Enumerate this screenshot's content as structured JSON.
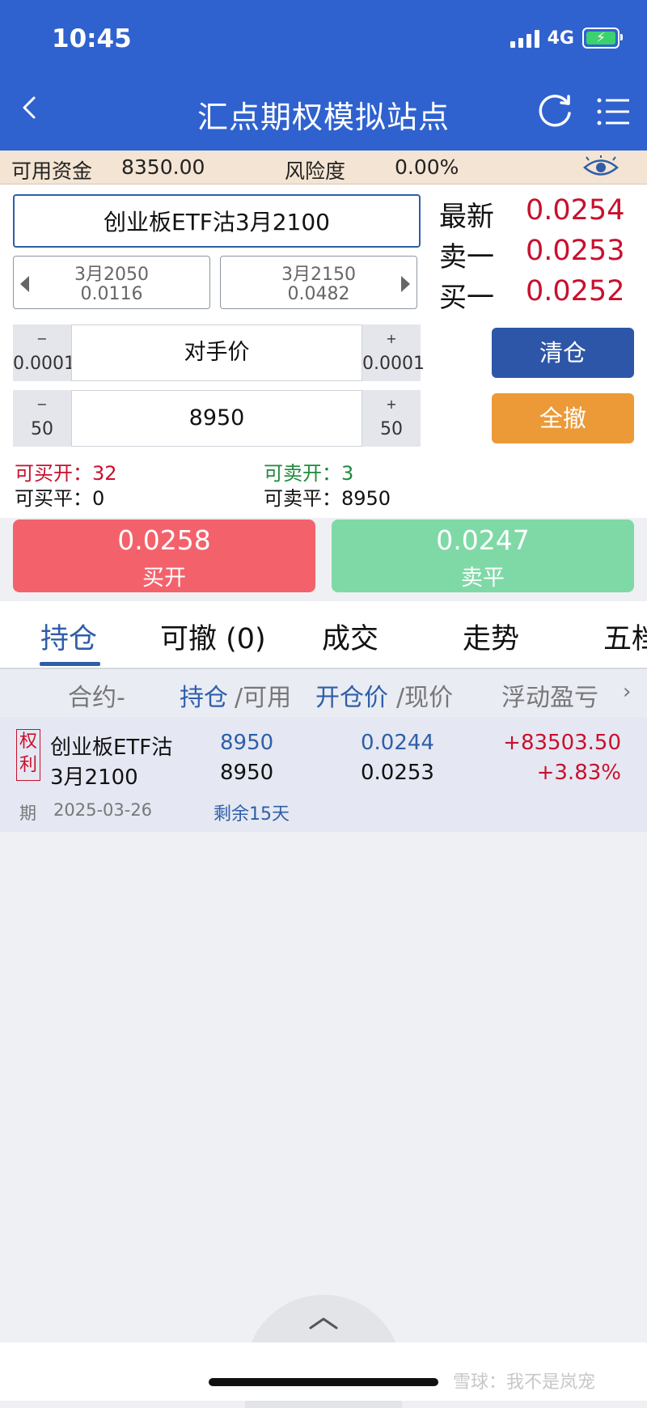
{
  "status_bar": {
    "time": "10:45",
    "network": "4G"
  },
  "header": {
    "title": "汇点期权模拟站点"
  },
  "account": {
    "funds_label": "可用资金",
    "funds_value": "8350.00",
    "risk_label": "风险度",
    "risk_value": "0.00%"
  },
  "contract": {
    "name": "创业板ETF沽3月2100"
  },
  "nav": {
    "prev": {
      "name": "3月2050",
      "price": "0.0116"
    },
    "next": {
      "name": "3月2150",
      "price": "0.0482"
    }
  },
  "quotes": [
    {
      "label": "最新",
      "value": "0.0254"
    },
    {
      "label": "卖一",
      "value": "0.0253"
    },
    {
      "label": "买一",
      "value": "0.0252"
    }
  ],
  "price_stepper": {
    "minus_symbol": "−",
    "plus_symbol": "+",
    "step": "0.0001",
    "value": "对手价"
  },
  "qty_stepper": {
    "minus_symbol": "−",
    "plus_symbol": "+",
    "step": "50",
    "value": "8950"
  },
  "buttons": {
    "clear": "清仓",
    "cancel_all": "全撤"
  },
  "availability": {
    "buy_open_label": "可买开：",
    "buy_open_value": "32",
    "buy_close_label": "可买平：",
    "buy_close_value": "0",
    "sell_open_label": "可卖开：",
    "sell_open_value": "3",
    "sell_close_label": "可卖平：",
    "sell_close_value": "8950"
  },
  "order": {
    "buy": {
      "price": "0.0258",
      "label": "买开"
    },
    "sell": {
      "price": "0.0247",
      "label": "卖平"
    }
  },
  "tabs": [
    "持仓",
    "可撤 (0)",
    "成交",
    "走势",
    "五档"
  ],
  "columns": {
    "contract": "合约-",
    "position": "持仓",
    "available": "/可用",
    "open_price": "开仓价",
    "current_price": "/现价",
    "pnl": "浮动盈亏",
    "more": "›"
  },
  "position": {
    "badge_1": "权",
    "badge_2": "利",
    "name_line1": "创业板ETF沽",
    "name_line2": "3月2100",
    "holding": "8950",
    "available": "8950",
    "open_price": "0.0244",
    "current_price": "0.0253",
    "pnl": "+83503.50",
    "pnl_pct": "+3.83%",
    "expiry_label": "期",
    "expiry_date": "2025-03-26",
    "remaining": "剩余15天"
  },
  "watermark": "雪球：我不是岚宠",
  "colors": {
    "header_blue": "#2f62cf",
    "clear_btn": "#2e56a8",
    "cancel_btn": "#eb9a37",
    "buy_btn": "#f3626b",
    "sell_btn": "#7fd9a6",
    "price_red": "#c8102e",
    "price_green": "#1f8a3c"
  }
}
